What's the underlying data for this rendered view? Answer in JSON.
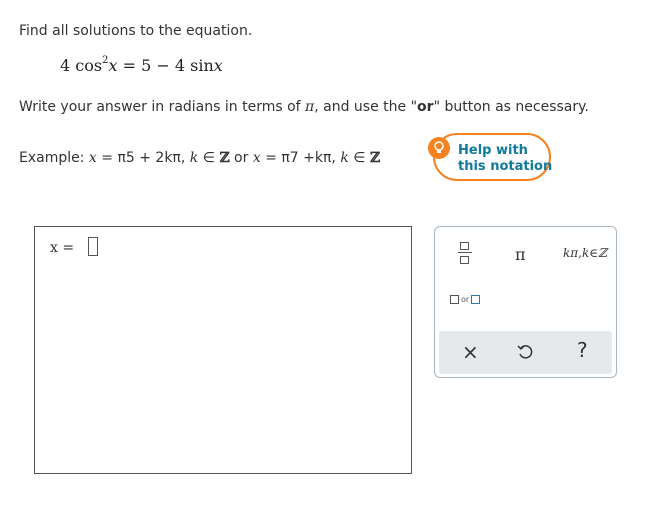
{
  "question": {
    "prompt": "Find all solutions to the equation.",
    "equation": {
      "coef_left": "4",
      "func": "cos",
      "exp": "2",
      "var": "x",
      "rhs": "= 5 − 4 sin",
      "rhs_var": "x"
    },
    "instructions_pre": "Write your answer in radians in terms of ",
    "instructions_pi": "π",
    "instructions_mid": ", and use the \"",
    "instructions_or": "or",
    "instructions_post": "\" button as necessary."
  },
  "example": {
    "label": "Example: ",
    "x1": "x",
    "eq1": " = ",
    "rhs1": "π5 + 2kπ, ",
    "k1": "k",
    "in1": " ∈ ",
    "Z1": "ℤ",
    "or": " or ",
    "x2": "x",
    "eq2": " = ",
    "rhs2": "π7 +kπ, ",
    "k2": "k",
    "in2": " ∈ ",
    "Z2": "ℤ"
  },
  "help": {
    "line1": "Help with",
    "line2": "this notation",
    "icon": "lightbulb-icon",
    "accent": "#f5821f",
    "text_color": "#117a9b"
  },
  "answer": {
    "prefix": "x =",
    "value": ""
  },
  "palette": {
    "fraction": "fraction-icon",
    "pi": "π",
    "kpi": "kπ,k∈ℤ",
    "or_label": "or",
    "clear": "×",
    "undo": "undo-icon",
    "help": "?"
  }
}
